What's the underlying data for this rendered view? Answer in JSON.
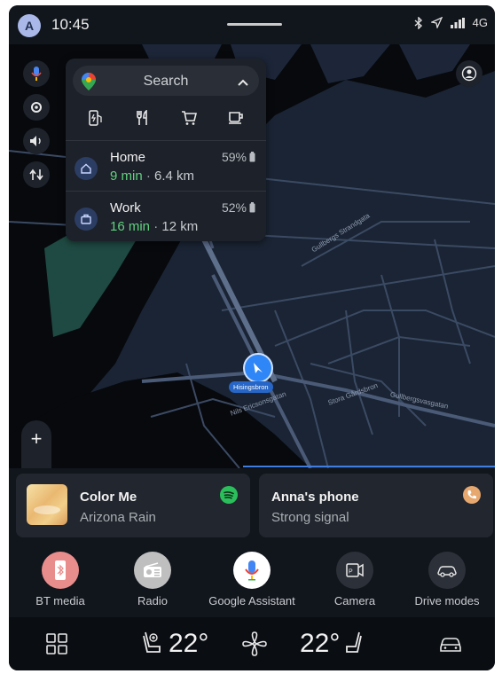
{
  "status_bar": {
    "avatar_letter": "A",
    "time": "10:45",
    "network": "4G",
    "icons": [
      "bluetooth-icon",
      "location-arrow-icon",
      "signal-icon"
    ]
  },
  "map": {
    "street_labels": [
      "Gullbergs Strandgata",
      "Hisingsbron",
      "Gullbergsvasgatan",
      "Stora Gårdsbron",
      "Nils Ericsonsgatan"
    ],
    "location_label": "Hisingsbron",
    "zoom_in_label": "+",
    "zoom_out_label": "−",
    "left_rail_icons": [
      "microphone-icon",
      "settings-icon",
      "volume-icon",
      "route-options-icon"
    ],
    "account_icon": "account-icon"
  },
  "search_panel": {
    "placeholder": "Search",
    "categories": [
      "ev-charging-icon",
      "restaurant-icon",
      "shopping-cart-icon",
      "coffee-icon"
    ],
    "destinations": [
      {
        "name": "Home",
        "eta": "9 min",
        "distance": "6.4 km",
        "battery": "59%",
        "icon": "home-icon"
      },
      {
        "name": "Work",
        "eta": "16 min",
        "distance": "12 km",
        "battery": "52%",
        "icon": "briefcase-icon"
      }
    ]
  },
  "cards": {
    "media": {
      "title": "Color Me",
      "artist": "Arizona Rain",
      "source_icon": "spotify-icon"
    },
    "phone": {
      "title": "Anna's phone",
      "status": "Strong signal",
      "icon": "phone-icon"
    }
  },
  "apps": [
    {
      "label": "BT media",
      "icon": "bt-media-icon",
      "color": "#e88c8c"
    },
    {
      "label": "Radio",
      "icon": "radio-icon",
      "color": "#bfbfbf"
    },
    {
      "label": "Google Assistant",
      "icon": "google-assistant-icon",
      "color": "#ffffff"
    },
    {
      "label": "Camera",
      "icon": "camera-icon",
      "color": "#2c3038"
    },
    {
      "label": "Drive modes",
      "icon": "drive-modes-icon",
      "color": "#2c3038"
    }
  ],
  "climate": {
    "driver_temp": "22°",
    "passenger_temp": "22°"
  },
  "colors": {
    "accent_blue": "#2f86f6",
    "eta_green": "#61d27f",
    "spotify_green": "#2bbf5c"
  }
}
